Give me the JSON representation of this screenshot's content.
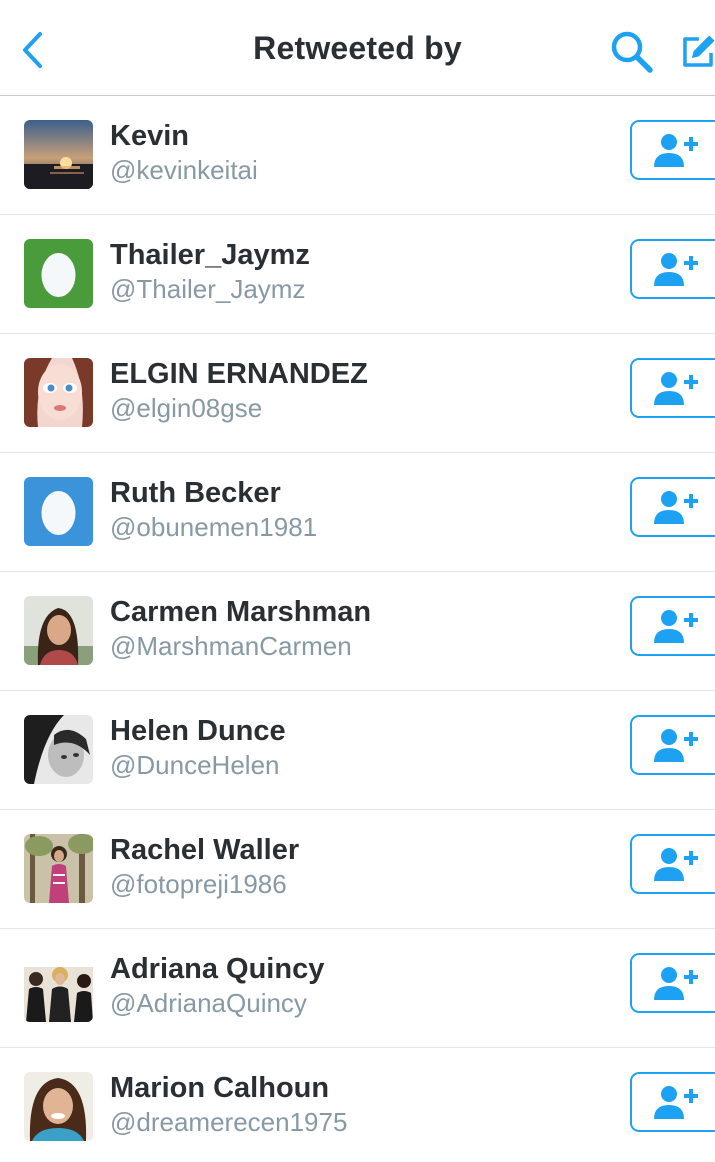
{
  "header": {
    "title": "Retweeted by",
    "back_icon": "chevron-left-icon",
    "search_icon": "search-icon",
    "compose_icon": "compose-icon"
  },
  "colors": {
    "accent": "#1da1f2",
    "name_text": "#292f33",
    "handle_text": "#8899a6",
    "divider": "#e1e8ed"
  },
  "users": [
    {
      "name": "Kevin",
      "handle": "@kevinkeitai",
      "avatar": "sunset-photo"
    },
    {
      "name": "Thailer_Jaymz",
      "handle": "@Thailer_Jaymz",
      "avatar": "default-egg-green"
    },
    {
      "name": "ELGIN ERNANDEZ",
      "handle": "@elgin08gse",
      "avatar": "cartoon-doll-face"
    },
    {
      "name": "Ruth Becker",
      "handle": "@obunemen1981",
      "avatar": "default-egg-blue"
    },
    {
      "name": "Carmen Marshman",
      "handle": "@MarshmanCarmen",
      "avatar": "woman-portrait"
    },
    {
      "name": "Helen Dunce",
      "handle": "@DunceHelen",
      "avatar": "black-white-portrait"
    },
    {
      "name": "Rachel Waller",
      "handle": "@fotopreji1986",
      "avatar": "woman-in-forest"
    },
    {
      "name": "Adriana Quincy",
      "handle": "@AdrianaQuincy",
      "avatar": "group-photo"
    },
    {
      "name": "Marion Calhoun",
      "handle": "@dreamerecen1975",
      "avatar": "woman-smiling"
    }
  ],
  "follow_button_icon": "follow-user-icon"
}
